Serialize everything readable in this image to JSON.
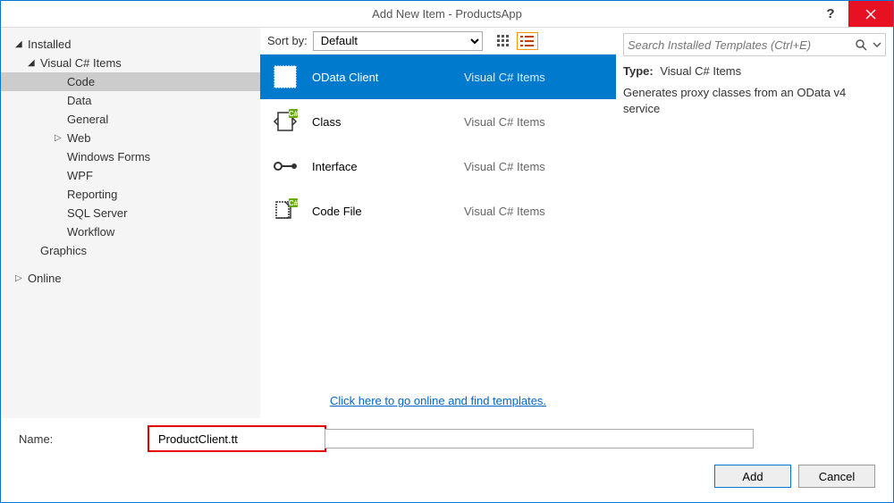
{
  "window": {
    "title": "Add New Item - ProductsApp"
  },
  "sidebar": {
    "installed": "Installed",
    "online": "Online",
    "tree": [
      {
        "label": "Visual C# Items",
        "level": 1,
        "expanded": true,
        "has_children": true
      },
      {
        "label": "Code",
        "level": 2,
        "selected": true
      },
      {
        "label": "Data",
        "level": 2
      },
      {
        "label": "General",
        "level": 2
      },
      {
        "label": "Web",
        "level": 2,
        "has_children": true,
        "expanded": false
      },
      {
        "label": "Windows Forms",
        "level": 2
      },
      {
        "label": "WPF",
        "level": 2
      },
      {
        "label": "Reporting",
        "level": 2
      },
      {
        "label": "SQL Server",
        "level": 2
      },
      {
        "label": "Workflow",
        "level": 2
      },
      {
        "label": "Graphics",
        "level": 1
      }
    ]
  },
  "toolbar": {
    "sort_label": "Sort by:",
    "sort_value": "Default"
  },
  "templates": [
    {
      "name": "OData Client",
      "lang": "Visual C# Items",
      "selected": true
    },
    {
      "name": "Class",
      "lang": "Visual C# Items"
    },
    {
      "name": "Interface",
      "lang": "Visual C# Items"
    },
    {
      "name": "Code File",
      "lang": "Visual C# Items"
    }
  ],
  "link": {
    "text": "Click here to go online and find templates."
  },
  "right": {
    "search_placeholder": "Search Installed Templates (Ctrl+E)",
    "type_label": "Type:",
    "type_value": "Visual C# Items",
    "description": "Generates proxy classes from an OData v4 service"
  },
  "footer": {
    "name_label": "Name:",
    "name_value": "ProductClient.tt",
    "add": "Add",
    "cancel": "Cancel"
  }
}
